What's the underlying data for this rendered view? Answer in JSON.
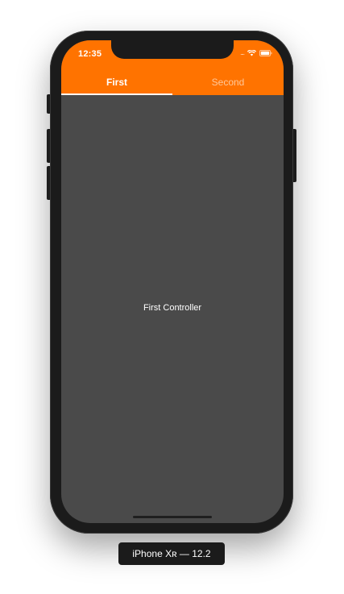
{
  "status_bar": {
    "time": "12:35",
    "signal": "....",
    "wifi_icon": "wifi-icon",
    "battery_icon": "battery-icon"
  },
  "tabs": [
    {
      "label": "First",
      "selected": true
    },
    {
      "label": "Second",
      "selected": false
    }
  ],
  "content": {
    "label": "First Controller"
  },
  "device_label": "iPhone Xʀ — 12.2",
  "colors": {
    "accent": "#ff7300",
    "background": "#4a4a4a",
    "bezel": "#1b1b1b"
  }
}
